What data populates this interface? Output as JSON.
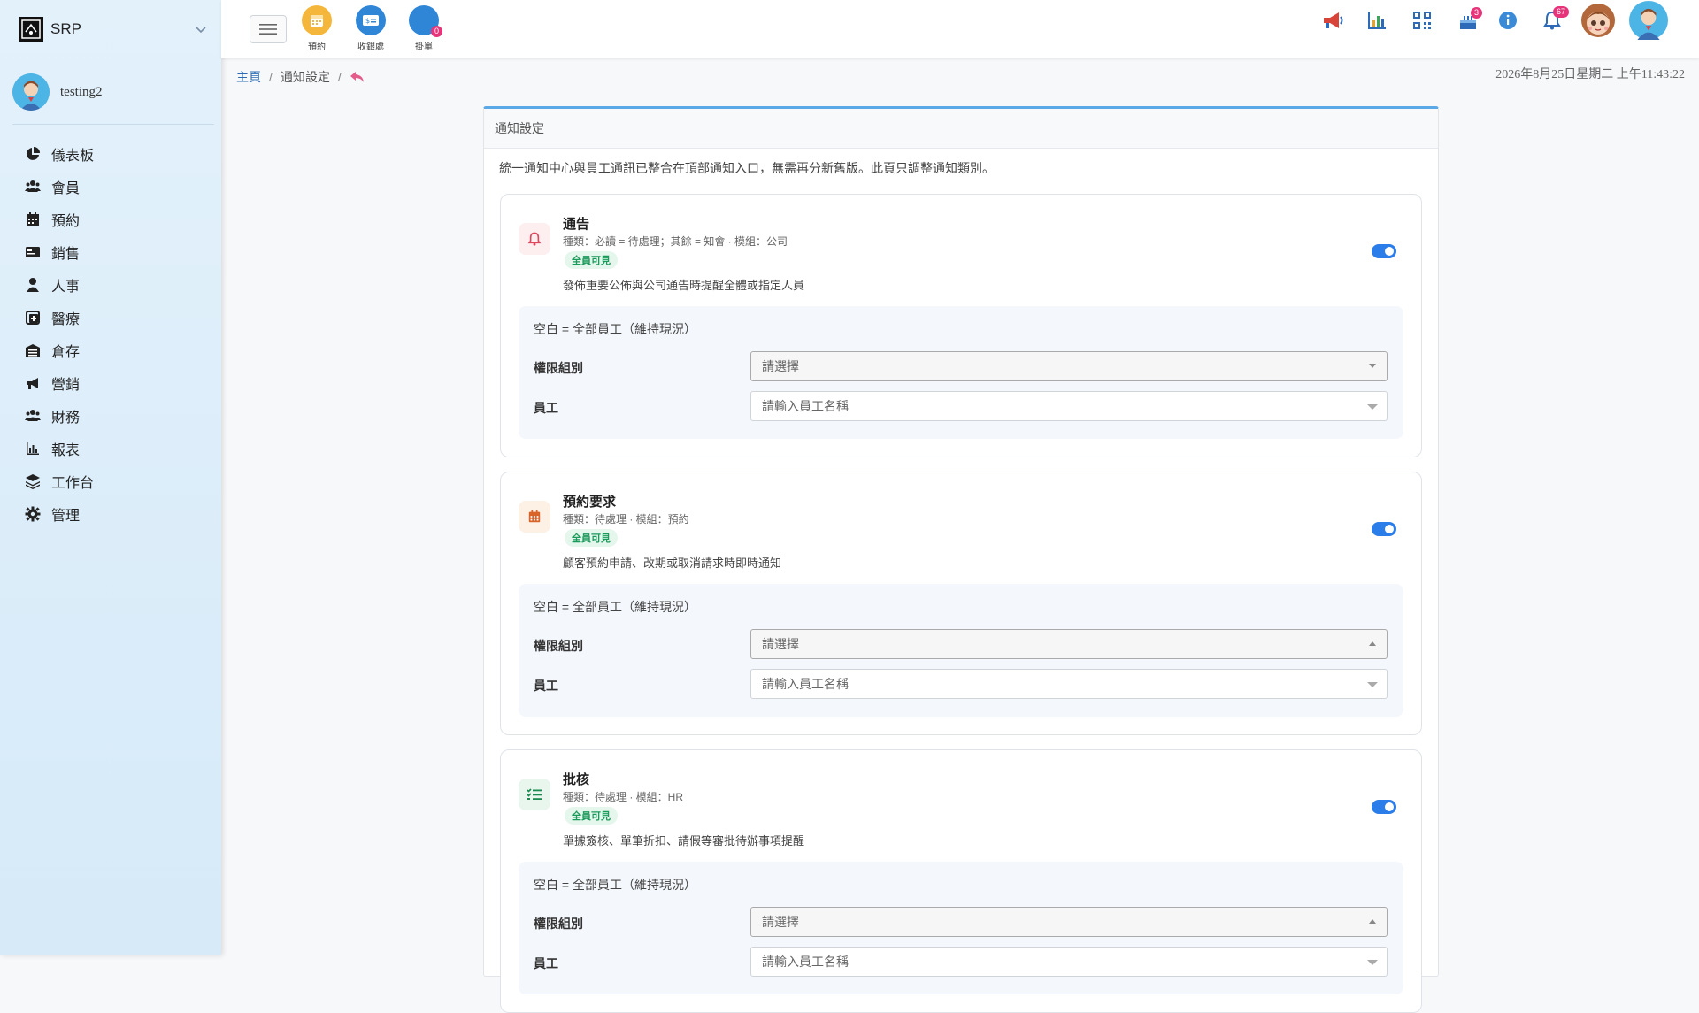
{
  "sidebar": {
    "brand": {
      "logo_text": "SRP",
      "name": "SRP"
    },
    "user": {
      "name": "testing2"
    },
    "items": [
      {
        "label": "儀表板",
        "icon": "pie-chart-icon"
      },
      {
        "label": "會員",
        "icon": "users-icon"
      },
      {
        "label": "預約",
        "icon": "calendar-icon"
      },
      {
        "label": "銷售",
        "icon": "card-icon"
      },
      {
        "label": "人事",
        "icon": "person-icon"
      },
      {
        "label": "醫療",
        "icon": "medical-icon"
      },
      {
        "label": "倉存",
        "icon": "warehouse-icon"
      },
      {
        "label": "營銷",
        "icon": "megaphone-icon"
      },
      {
        "label": "財務",
        "icon": "finance-users-icon"
      },
      {
        "label": "報表",
        "icon": "bar-chart-icon"
      },
      {
        "label": "工作台",
        "icon": "layers-icon"
      },
      {
        "label": "管理",
        "icon": "gear-icon"
      }
    ]
  },
  "topbar": {
    "quick": [
      {
        "label": "預約",
        "color": "#f5b73b"
      },
      {
        "label": "收銀處",
        "color": "#2f86d6"
      },
      {
        "label": "掛單",
        "color": "#2f86d6",
        "badge": "0"
      }
    ],
    "icons": {
      "megaphone_badge": "",
      "cake_badge": "3",
      "bell_badge": "67"
    }
  },
  "breadcrumb": {
    "home": "主頁",
    "current": "通知設定"
  },
  "datetime": "2026年8月25日星期二 上午11:43:22",
  "card": {
    "header": "通知設定",
    "desc": "統一通知中心與員工通訊已整合在頂部通知入口，無需再分新舊版。此頁只調整通知類別。",
    "sections": [
      {
        "title": "通告",
        "meta": "種類：必讀 = 待處理；其餘 = 知會 · 模組：公司",
        "badge": "全員可見",
        "desc": "發佈重要公佈與公司通告時提醒全體或指定人員",
        "hint": "空白 = 全部員工（維持現況）",
        "group_label": "權限組別",
        "group_placeholder": "請選擇",
        "staff_label": "員工",
        "staff_placeholder": "請輸入員工名稱"
      },
      {
        "title": "預約要求",
        "meta": "種類：待處理 · 模組：預約",
        "badge": "全員可見",
        "desc": "顧客預約申請、改期或取消請求時即時通知",
        "hint": "空白 = 全部員工（維持現況）",
        "group_label": "權限組別",
        "group_placeholder": "請選擇",
        "staff_label": "員工",
        "staff_placeholder": "請輸入員工名稱"
      },
      {
        "title": "批核",
        "meta": "種類：待處理 · 模組：HR",
        "badge": "全員可見",
        "desc": "單據簽核、單筆折扣、請假等審批待辦事項提醒",
        "hint": "空白 = 全部員工（維持現況）",
        "group_label": "權限組別",
        "group_placeholder": "請選擇",
        "staff_label": "員工",
        "staff_placeholder": "請輸入員工名稱"
      }
    ]
  }
}
